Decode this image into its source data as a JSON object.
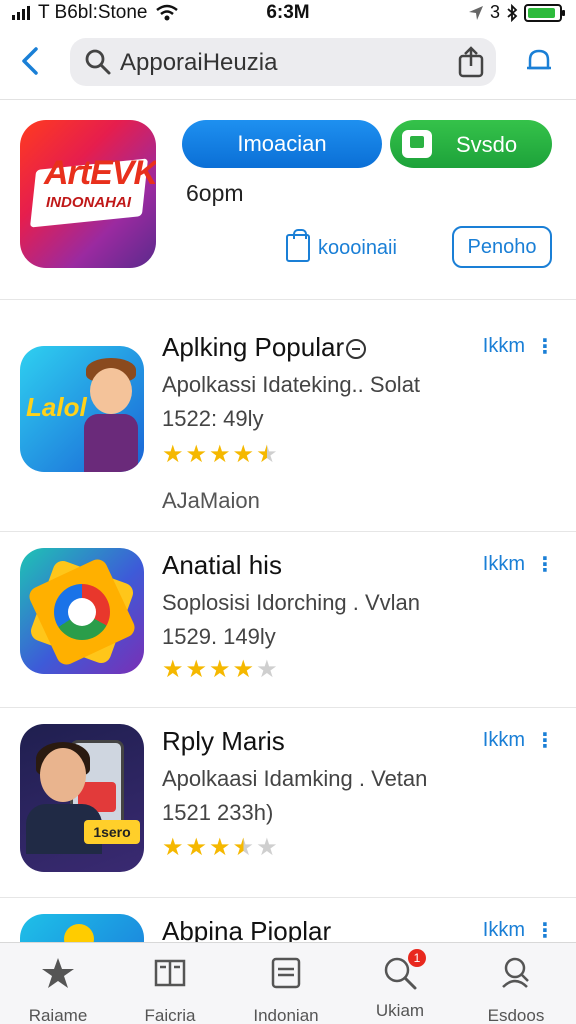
{
  "status_bar": {
    "carrier": "T B6bl:Stone",
    "time": "6:3M",
    "right_text": "3",
    "battery_level": 0.9
  },
  "header": {
    "search_query": "ApporaiHeuzia",
    "icons": [
      "back-chevron-icon",
      "search-icon",
      "share-icon",
      "notification-icon"
    ]
  },
  "featured": {
    "icon_text_top": "ArtEVK",
    "icon_text_bottom": "INDONAHAI",
    "primary_button": "Imoacian",
    "secondary_button": "Svsdo",
    "subtitle": "6opm",
    "link_action": "koooinaii",
    "outline_button": "Penoho"
  },
  "apps": [
    {
      "title": "Aplking Popular",
      "subtitle": "Apolkassi Idateking.. Solat",
      "meta": "1522: 49ly",
      "rating": 4.5,
      "extra": "AJaMaion",
      "get_label": "Ikkm",
      "icon_word": "Lalol"
    },
    {
      "title": "Anatial his",
      "subtitle": "Soplosisi Idorching . Vvlan",
      "meta": "1529. 149ly",
      "rating": 4,
      "get_label": "Ikkm"
    },
    {
      "title": "Rply Maris",
      "subtitle": "Apolkaasi Idamking . Vetan",
      "meta": "1521 233h)",
      "rating": 3.5,
      "get_label": "Ikkm",
      "icon_tag": "1sero"
    },
    {
      "title": "Abpina Pioplar",
      "get_label": "Ikkm"
    }
  ],
  "tab_bar": {
    "tabs": [
      {
        "label": "Raiame",
        "icon": "star-icon"
      },
      {
        "label": "Faicria",
        "icon": "book-icon"
      },
      {
        "label": "Indonian",
        "icon": "list-icon"
      },
      {
        "label": "Ukiam",
        "icon": "search-icon",
        "badge": "1"
      },
      {
        "label": "Esdoos",
        "icon": "profile-search-icon"
      }
    ]
  },
  "colors": {
    "accent": "#1a7fd6",
    "primary_button": "#0b6fd6",
    "green_button": "#1da23a",
    "star": "#f5b800",
    "badge": "#e8281e"
  }
}
